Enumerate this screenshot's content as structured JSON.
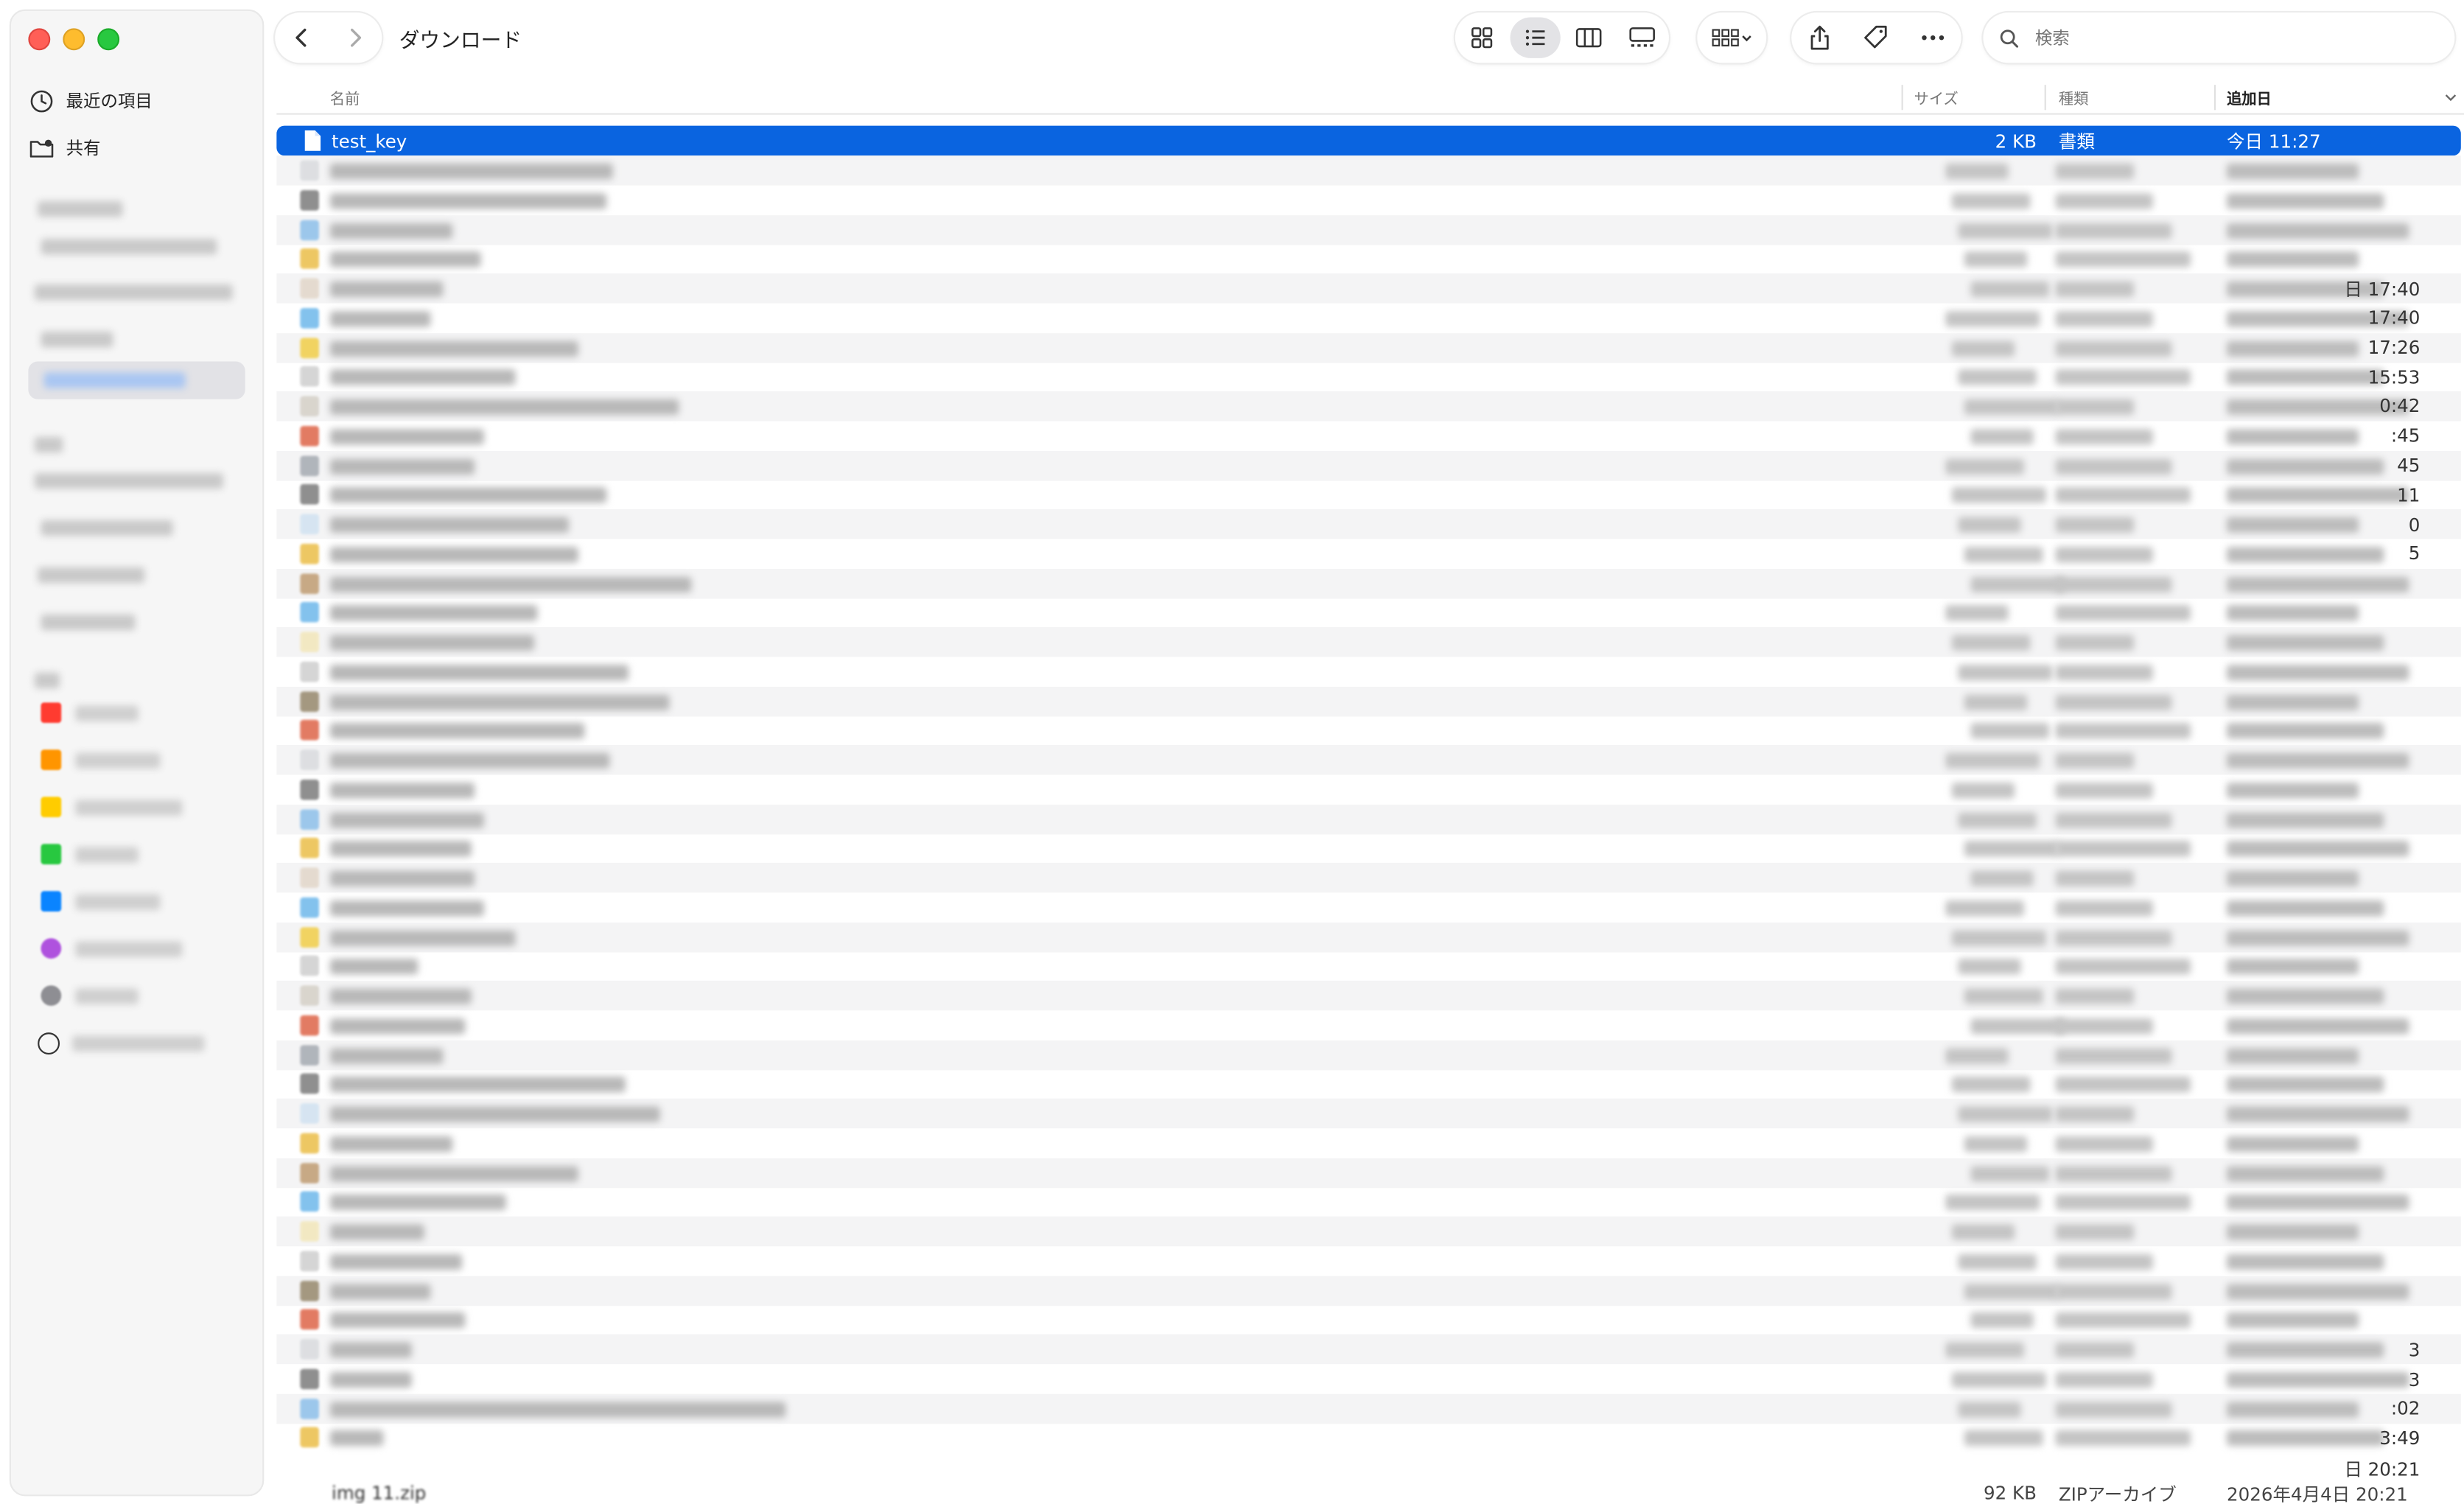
{
  "window": {
    "title": "ダウンロード"
  },
  "sidebar": {
    "items": [
      {
        "label": "最近の項目",
        "icon": "clock-icon"
      },
      {
        "label": "共有",
        "icon": "shared-folder-icon"
      }
    ],
    "tag_colors": [
      "#ff3b30",
      "#ff9500",
      "#ffcc00",
      "#28c840",
      "#0a84ff",
      "#af52de",
      "#8e8e93"
    ]
  },
  "toolbar": {
    "back_icon": "chevron-left-icon",
    "forward_icon": "chevron-right-icon",
    "views": [
      "icon-view-icon",
      "list-view-icon",
      "column-view-icon",
      "gallery-view-icon"
    ],
    "active_view": "list-view-icon",
    "group_icon": "group-by-icon",
    "share_icon": "share-icon",
    "tag_icon": "tag-icon",
    "more_icon": "ellipsis-icon"
  },
  "search": {
    "placeholder": "検索"
  },
  "columns": {
    "name": "名前",
    "size": "サイズ",
    "kind": "種類",
    "date_added": "追加日"
  },
  "selected_file": {
    "name": "test_key",
    "size": "2 KB",
    "kind": "書類",
    "date_added": "今日 11:27"
  },
  "last_file": {
    "name": "img 11.zip",
    "size": "92 KB",
    "kind": "ZIPアーカイブ",
    "date_added": "2026年4月4日 20:21"
  },
  "visible_time_fragments": [
    "日 17:40",
    "17:40",
    "17:26",
    "15:53",
    "0:42",
    ":45",
    "45",
    "11",
    "0",
    "5",
    "3",
    "3",
    ":02",
    "3:49",
    "日 20:21"
  ],
  "accent_color": "#0a64e0"
}
